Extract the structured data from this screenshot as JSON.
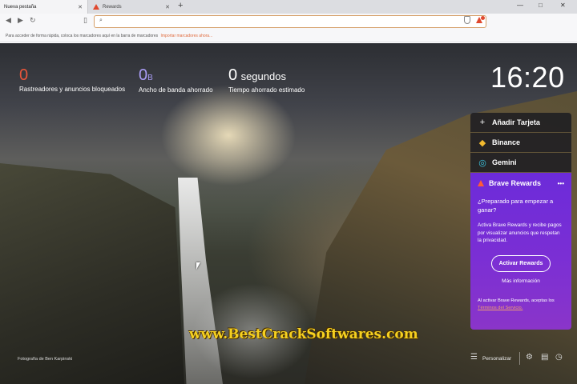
{
  "tabs": [
    {
      "label": "Nueva pestaña",
      "active": true
    },
    {
      "label": "Rewards",
      "active": false
    }
  ],
  "window_controls": [
    "—",
    "□",
    "✕"
  ],
  "address_bar": {
    "value": "",
    "placeholder": ""
  },
  "bookmarks_bar": {
    "hint": "Para acceder de forma rápida, coloca los marcadores aquí en la barra de marcadores",
    "import_link": "Importar marcadores ahora..."
  },
  "stats": {
    "trackers": {
      "value": "0",
      "label": "Rastreadores y anuncios bloqueados"
    },
    "bandwidth": {
      "value": "0",
      "unit": "B",
      "label": "Ancho de banda ahorrado"
    },
    "time": {
      "value": "0",
      "unit": "segundos",
      "label": "Tiempo ahorrado estimado"
    }
  },
  "clock": "16:20",
  "widgets": {
    "add_card": "Añadir Tarjeta",
    "binance": "Binance",
    "gemini": "Gemini"
  },
  "rewards": {
    "title": "Brave Rewards",
    "menu": "•••",
    "heading": "¿Preparado para empezar a ganar?",
    "body": "Activa Brave Rewards y recibe pagos por visualizar anuncios que respetan la privacidad.",
    "button": "Activar Rewards",
    "more_info": "Más información",
    "terms_prefix": "Al activar Brave Rewards, aceptas los",
    "terms_link": "Términos del Servicio."
  },
  "photo_credit": "Fotografía de Ben Karpinski",
  "watermark": "www.BestCrackSoftwares.com",
  "customize": "Personalizar",
  "colors": {
    "accent": "#e8553a",
    "rewards_purple": "#6c2bd9",
    "bandwidth": "#a99cf5"
  },
  "icons": [
    "search-icon",
    "shield-icon",
    "bookmark-icon",
    "settings-icon",
    "history-icon",
    "bookmarks-icon",
    "customize-icon",
    "binance-icon",
    "gemini-icon"
  ]
}
